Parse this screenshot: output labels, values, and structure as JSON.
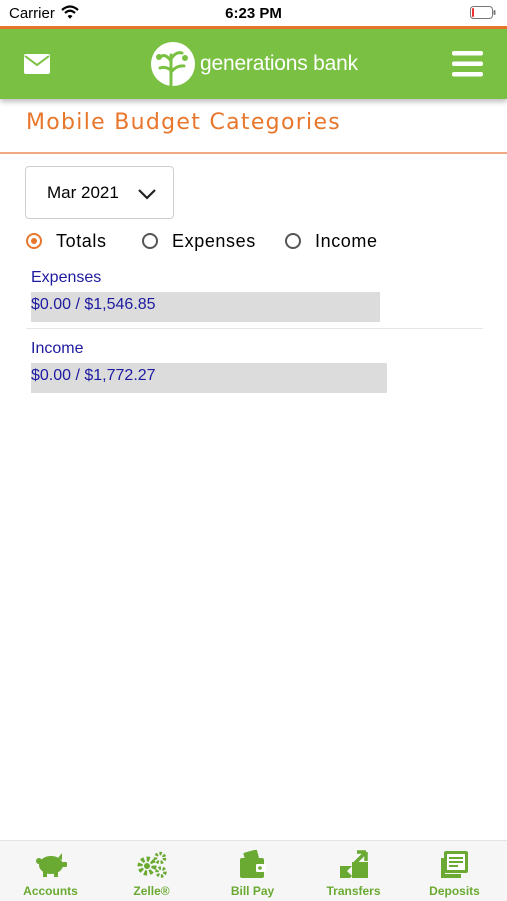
{
  "status_bar": {
    "carrier": "Carrier",
    "time": "6:23 PM"
  },
  "header": {
    "brand": "generations bank"
  },
  "page": {
    "title": "Mobile Budget Categories"
  },
  "month_selector": {
    "value": "Mar 2021"
  },
  "view_options": [
    {
      "label": "Totals",
      "selected": true
    },
    {
      "label": "Expenses",
      "selected": false
    },
    {
      "label": "Income",
      "selected": false
    }
  ],
  "categories": [
    {
      "name": "Expenses",
      "amount": "$0.00 / $1,546.85",
      "spent_fraction": 0.0
    },
    {
      "name": "Income",
      "amount": "$0.00 / $1,772.27",
      "spent_fraction": 0.0
    }
  ],
  "tabs": [
    {
      "label": "Accounts",
      "icon": "piggy-bank-icon"
    },
    {
      "label": "Zelle®",
      "icon": "gears-icon"
    },
    {
      "label": "Bill Pay",
      "icon": "wallet-icon"
    },
    {
      "label": "Transfers",
      "icon": "transfer-arrows-icon"
    },
    {
      "label": "Deposits",
      "icon": "check-deposit-icon"
    }
  ],
  "colors": {
    "brand_green": "#7ac143",
    "accent_orange": "#e8762b",
    "text_blue": "#1d1aa0"
  }
}
